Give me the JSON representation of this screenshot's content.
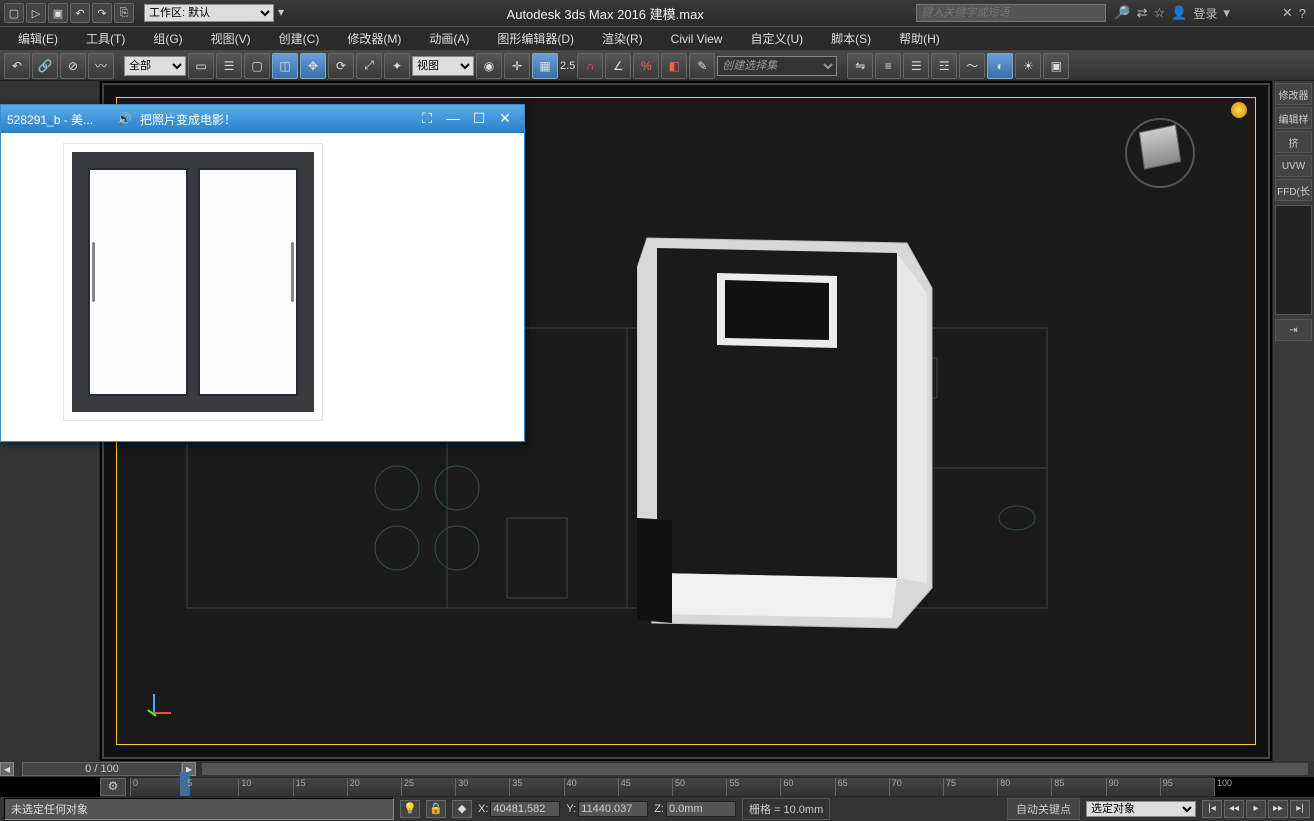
{
  "titlebar": {
    "workspace_label": "工作区: 默认",
    "app_title": "Autodesk 3ds Max 2016     建模.max",
    "search_placeholder": "键入关键字或短语",
    "login": "登录"
  },
  "menu": {
    "edit": "编辑(E)",
    "tools": "工具(T)",
    "group": "组(G)",
    "views": "视图(V)",
    "create": "创建(C)",
    "modifiers": "修改器(M)",
    "animation": "动画(A)",
    "graph": "图形编辑器(D)",
    "render": "渲染(R)",
    "civil": "Civil View",
    "custom": "自定义(U)",
    "script": "脚本(S)",
    "help": "帮助(H)"
  },
  "toolbar": {
    "filter_all": "全部",
    "ref_view": "视图",
    "spinner": "2.5",
    "named_sel_placeholder": "创建选择集"
  },
  "rightpanel": {
    "modify": "修改器",
    "edit": "编辑样",
    "select": "挤",
    "uvw": "UVW",
    "ffd": "FFD(长"
  },
  "viewport": {},
  "imageviewer": {
    "title_left": "528291_b - 美...",
    "title_right": "把照片变成电影！"
  },
  "timeline": {
    "frame_display": "0 / 100",
    "ticks": [
      "0",
      "5",
      "10",
      "15",
      "20",
      "25",
      "30",
      "35",
      "40",
      "45",
      "50",
      "55",
      "60",
      "65",
      "70",
      "75",
      "80",
      "85",
      "90",
      "95",
      "100"
    ]
  },
  "status": {
    "message": "未选定任何对象",
    "x": "40481.582",
    "y": "11440.037",
    "z": "0.0mm",
    "grid": "栅格 = 10.0mm",
    "autokey": "自动关键点",
    "keymode": "选定对象"
  }
}
